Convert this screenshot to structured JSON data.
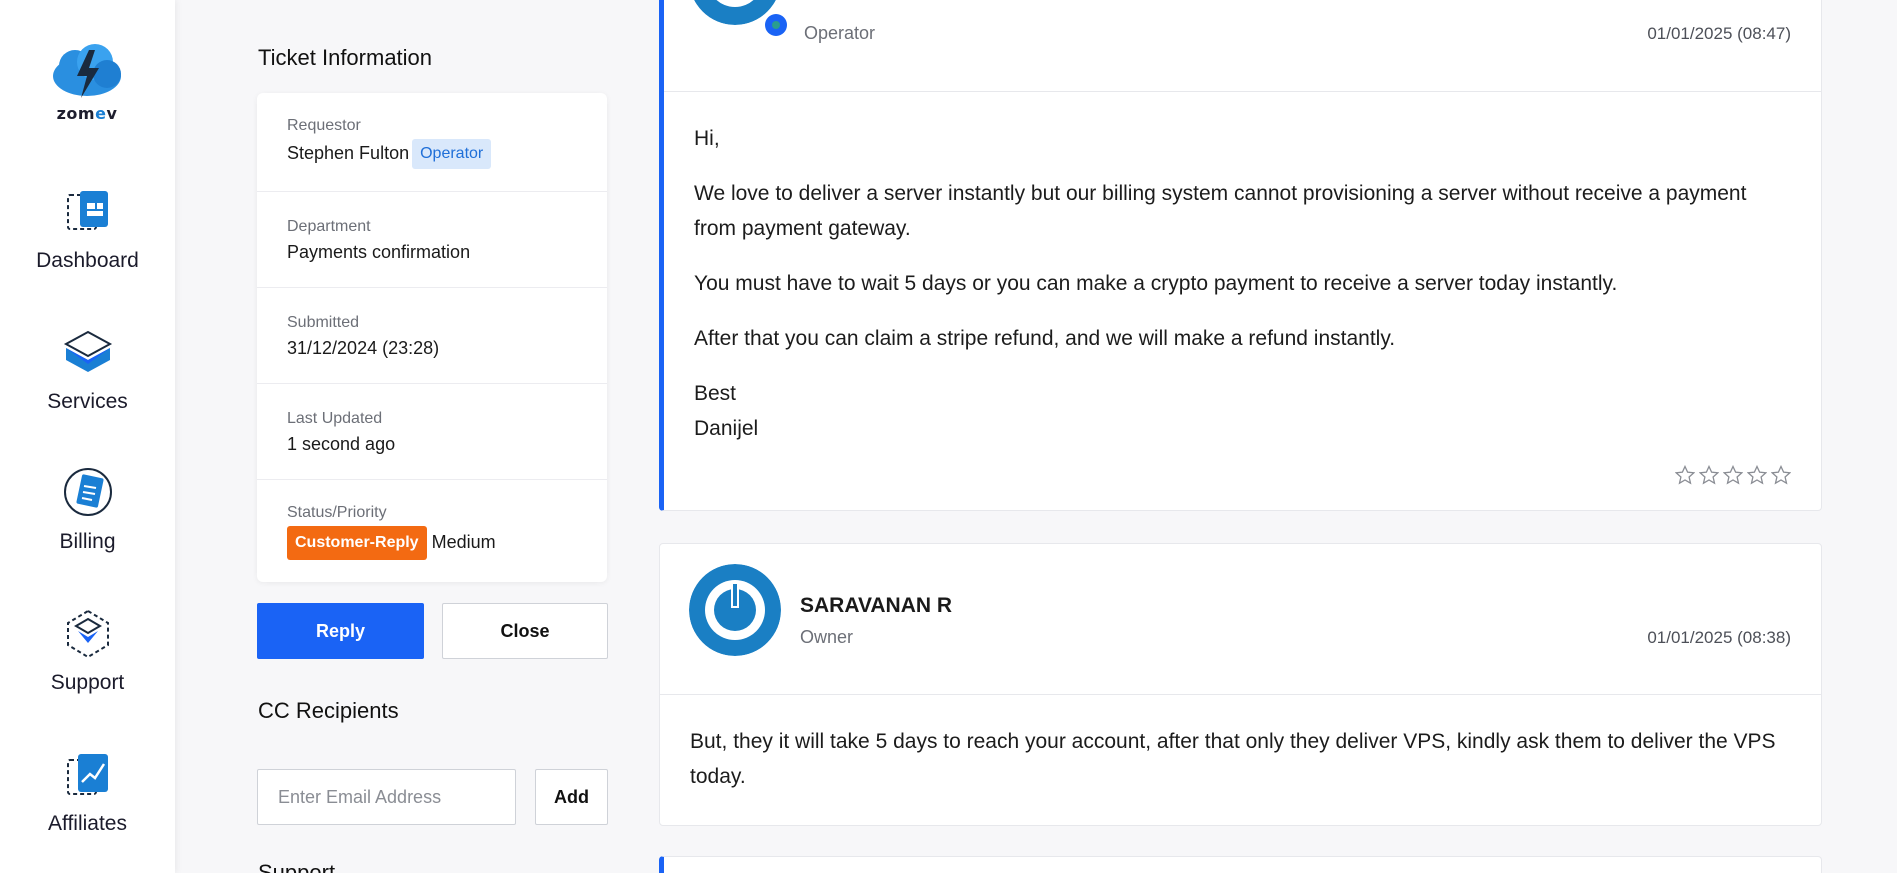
{
  "brand": {
    "name_prefix": "zom",
    "name_e": "e",
    "name_suffix": "v",
    "accent": "#1a7fd4"
  },
  "sidebar": {
    "items": [
      {
        "label": "Dashboard",
        "icon": "dashboard-icon"
      },
      {
        "label": "Services",
        "icon": "services-icon"
      },
      {
        "label": "Billing",
        "icon": "billing-icon"
      },
      {
        "label": "Support",
        "icon": "support-icon"
      },
      {
        "label": "Affiliates",
        "icon": "affiliates-icon"
      }
    ]
  },
  "ticket_info": {
    "title": "Ticket Information",
    "requestor_label": "Requestor",
    "requestor_name": "Stephen Fulton",
    "requestor_badge": "Operator",
    "department_label": "Department",
    "department_value": "Payments confirmation",
    "submitted_label": "Submitted",
    "submitted_value": "31/12/2024 (23:28)",
    "last_updated_label": "Last Updated",
    "last_updated_value": "1 second ago",
    "status_label": "Status/Priority",
    "status_value": "Customer-Reply",
    "priority_value": "Medium",
    "status_color": "#f36a12"
  },
  "actions": {
    "reply_label": "Reply",
    "close_label": "Close",
    "reply_color": "#1a63f5"
  },
  "cc": {
    "title": "CC Recipients",
    "email_placeholder": "Enter Email Address",
    "add_label": "Add"
  },
  "support_title_partial": "Support",
  "messages": [
    {
      "role": "Operator",
      "date": "01/01/2025 (08:47)",
      "body": [
        "Hi,",
        "We love to deliver a server instantly but our billing system cannot provisioning a server without receive a payment from payment gateway.",
        "You must have to wait 5 days or you can make a crypto payment to receive a server today instantly.",
        "After that you can claim a stripe refund, and we will make a refund instantly."
      ],
      "signoff_1": "Best",
      "signoff_2": "Danijel",
      "rating_max": 5,
      "rating_value": 0
    },
    {
      "name": "SARAVANAN R",
      "role": "Owner",
      "date": "01/01/2025 (08:38)",
      "body": [
        "But, they it will take 5 days to reach your account, after that only they deliver VPS, kindly ask them to deliver the VPS today."
      ]
    }
  ]
}
